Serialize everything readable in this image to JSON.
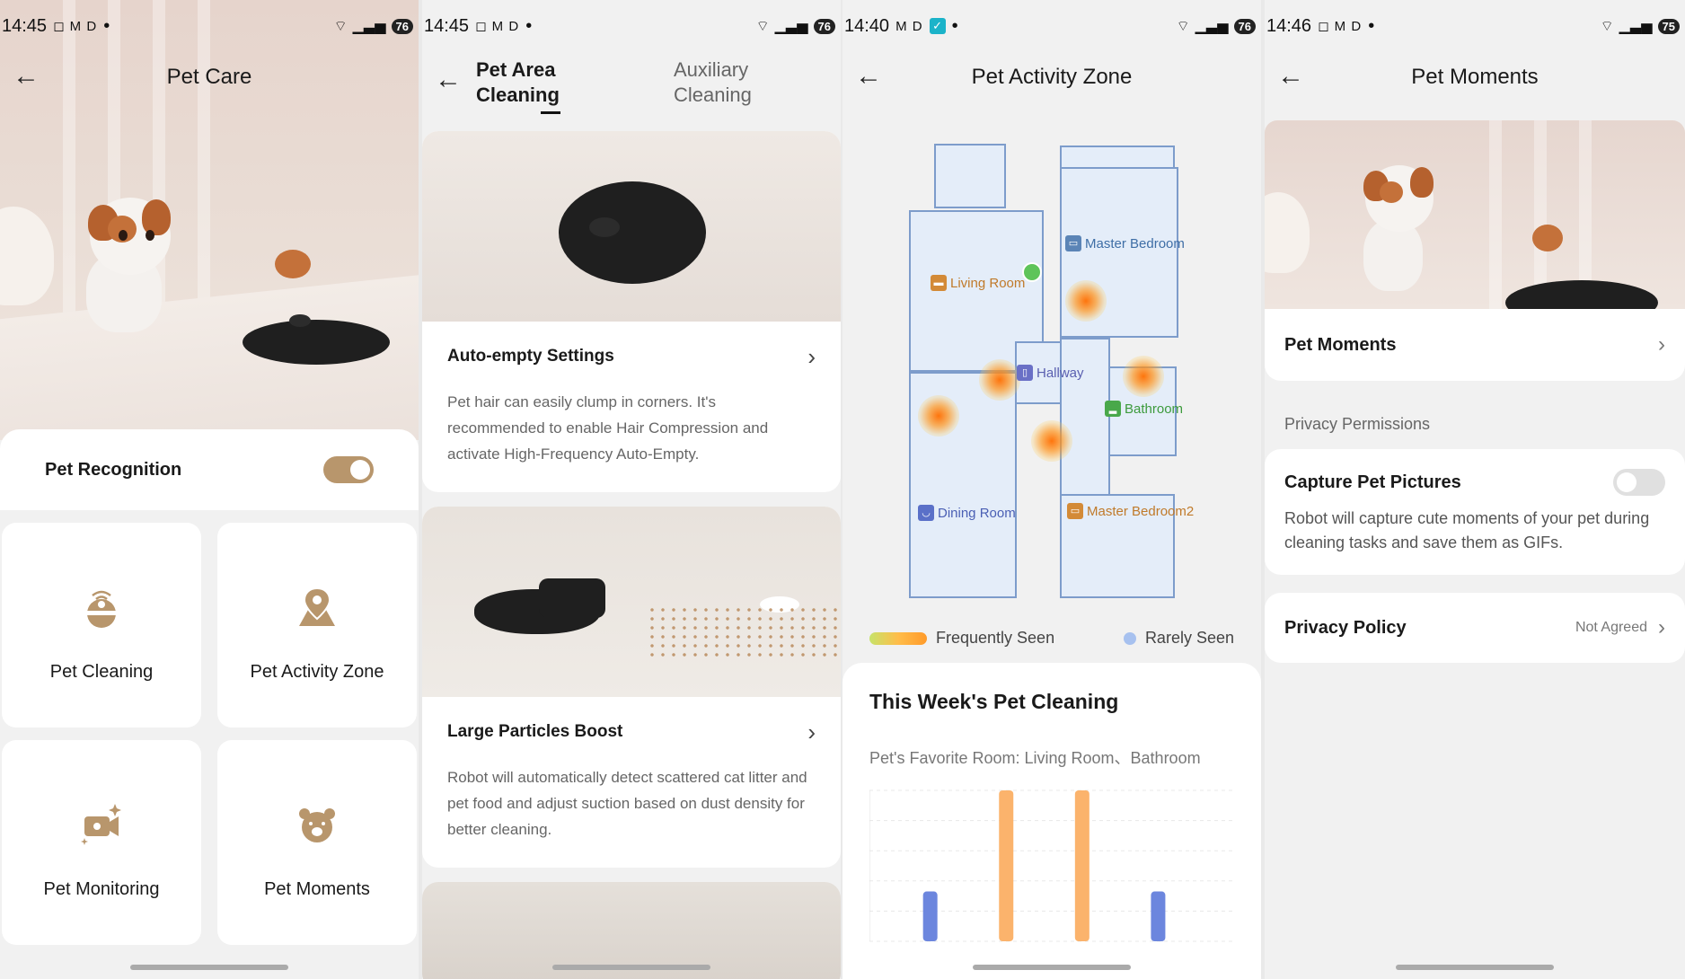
{
  "screens": [
    {
      "status": {
        "time": "14:45",
        "icons": "◻ M D",
        "battery": "76"
      },
      "title": "Pet Care",
      "pet_recognition": {
        "label": "Pet Recognition",
        "enabled": true
      },
      "tiles": [
        {
          "label": "Pet Cleaning",
          "icon": "robot-cleaning-icon"
        },
        {
          "label": "Pet Activity Zone",
          "icon": "location-pin-icon"
        },
        {
          "label": "Pet Monitoring",
          "icon": "video-camera-icon"
        },
        {
          "label": "Pet Moments",
          "icon": "pet-face-icon"
        }
      ]
    },
    {
      "status": {
        "time": "14:45",
        "icons": "◻ M D",
        "battery": "76"
      },
      "tabs": [
        {
          "label_line1": "Pet Area",
          "label_line2": "Cleaning",
          "active": true
        },
        {
          "label_line1": "Auxiliary",
          "label_line2": "Cleaning",
          "active": false
        }
      ],
      "features": [
        {
          "title": "Auto-empty Settings",
          "desc": "Pet hair can easily clump in corners. It's recommended to enable Hair Compression and activate High-Frequency Auto-Empty."
        },
        {
          "title": "Large Particles Boost",
          "desc": "Robot will automatically detect scattered cat litter and pet food and adjust suction based on dust density for better cleaning."
        }
      ]
    },
    {
      "status": {
        "time": "14:40",
        "icons": "M D",
        "battery": "76"
      },
      "title": "Pet Activity Zone",
      "rooms": {
        "master_bedroom": "Master Bedroom",
        "living_room": "Living Room",
        "hallway": "Hallway",
        "bathroom": "Bathroom",
        "dining_room": "Dining Room",
        "master_bedroom2": "Master Bedroom2"
      },
      "legend": {
        "frequent": "Frequently Seen",
        "rare": "Rarely Seen"
      },
      "week": {
        "title": "This Week's Pet Cleaning",
        "favorite": "Pet's Favorite Room: Living Room、Bathroom"
      },
      "chart_data": {
        "type": "bar",
        "title": "",
        "xlabel": "",
        "ylabel": "",
        "values": [
          0.33,
          1.0,
          1.0,
          0.33
        ],
        "colors": [
          "#6c86de",
          "#fbb36c",
          "#fbb36c",
          "#6c86de"
        ],
        "ylim": [
          0,
          1
        ],
        "grid": true
      },
      "colors": {
        "accent": "#b8966c",
        "map_fill": "#e4edf9",
        "map_stroke": "#7d9ccb"
      }
    },
    {
      "status": {
        "time": "14:46",
        "icons": "◻ M D",
        "battery": "75"
      },
      "title": "Pet Moments",
      "moments_row": "Pet Moments",
      "privacy_section": "Privacy Permissions",
      "capture": {
        "label": "Capture Pet Pictures",
        "desc": "Robot will capture cute moments of your pet during cleaning tasks and save them as GIFs.",
        "enabled": false
      },
      "policy": {
        "label": "Privacy Policy",
        "status": "Not Agreed"
      }
    }
  ]
}
